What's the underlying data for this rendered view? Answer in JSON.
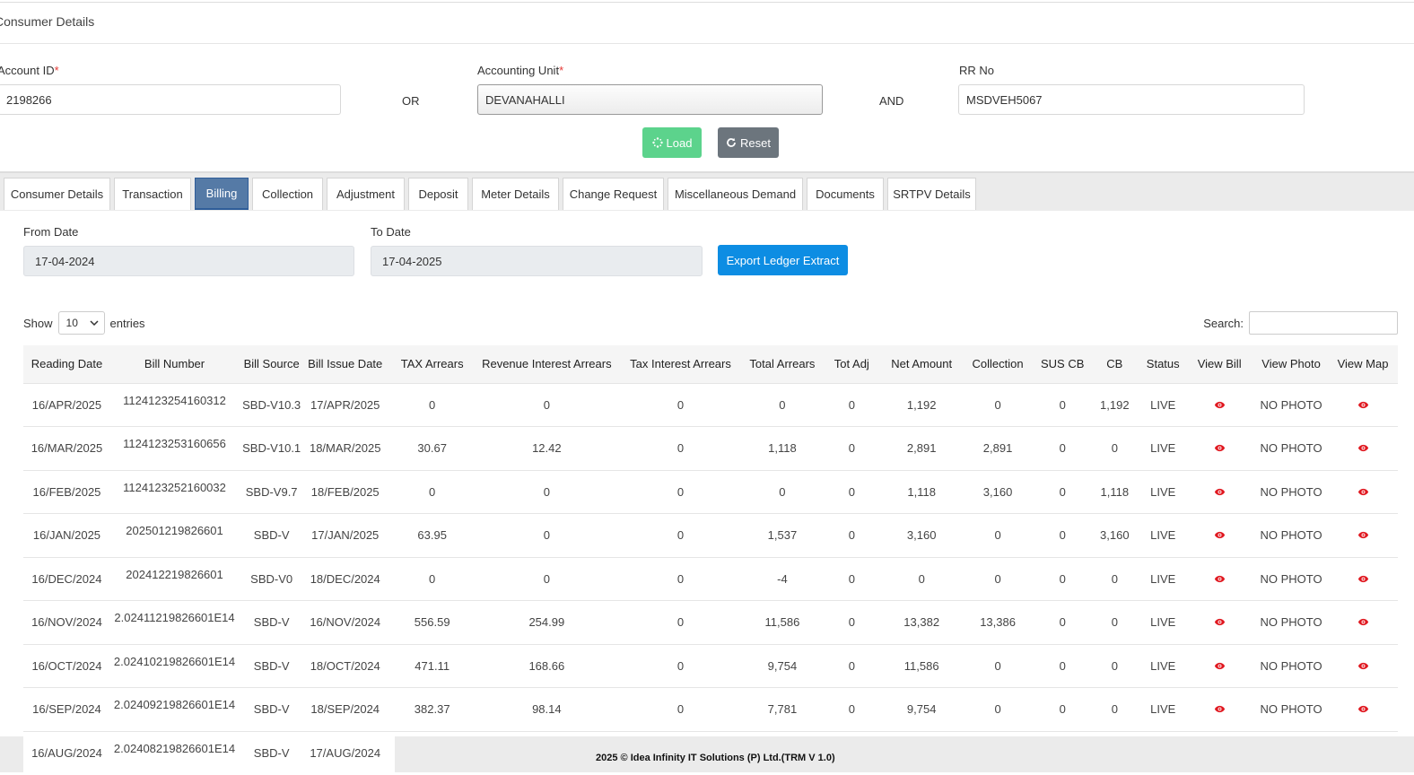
{
  "header": {
    "title": "Consumer Details"
  },
  "form": {
    "account_id": {
      "label": "Account ID",
      "required": "*",
      "value": "2198266"
    },
    "or_label": "OR",
    "accounting_unit": {
      "label": "Accounting Unit",
      "required": "*",
      "value": "DEVANAHALLI"
    },
    "and_label": "AND",
    "rr_no": {
      "label": "RR No",
      "value": "MSDVEH5067"
    },
    "load_label": "Load",
    "reset_label": "Reset"
  },
  "tabs": [
    {
      "label": "Consumer Details"
    },
    {
      "label": "Transaction"
    },
    {
      "label": "Billing",
      "active": true
    },
    {
      "label": "Collection"
    },
    {
      "label": "Adjustment"
    },
    {
      "label": "Deposit"
    },
    {
      "label": "Meter Details"
    },
    {
      "label": "Change Request"
    },
    {
      "label": "Miscellaneous Demand"
    },
    {
      "label": "Documents"
    },
    {
      "label": "SRTPV Details"
    }
  ],
  "billing": {
    "from_date": {
      "label": "From Date",
      "value": "17-04-2024"
    },
    "to_date": {
      "label": "To Date",
      "value": "17-04-2025"
    },
    "export_label": "Export Ledger Extract",
    "show_label": "Show",
    "page_length": "10",
    "entries_label": "entries",
    "search_label": "Search:"
  },
  "table": {
    "columns": [
      "Reading Date",
      "Bill Number",
      "Bill Source",
      "Bill Issue Date",
      "TAX Arrears",
      "Revenue Interest Arrears",
      "Tax Interest Arrears",
      "Total Arrears",
      "Tot Adj",
      "Net Amount",
      "Collection",
      "SUS CB",
      "CB",
      "Status",
      "View Bill",
      "View Photo",
      "View Map"
    ],
    "rows": [
      [
        "16/APR/2025",
        "1124123254160312",
        "SBD-V10.3",
        "17/APR/2025",
        "0",
        "0",
        "0",
        "0",
        "0",
        "1,192",
        "0",
        "0",
        "1,192",
        "LIVE",
        "",
        "NO PHOTO",
        ""
      ],
      [
        "16/MAR/2025",
        "1124123253160656",
        "SBD-V10.1",
        "18/MAR/2025",
        "30.67",
        "12.42",
        "0",
        "1,118",
        "0",
        "2,891",
        "2,891",
        "0",
        "0",
        "LIVE",
        "",
        "NO PHOTO",
        ""
      ],
      [
        "16/FEB/2025",
        "1124123252160032",
        "SBD-V9.7",
        "18/FEB/2025",
        "0",
        "0",
        "0",
        "0",
        "0",
        "1,118",
        "3,160",
        "0",
        "1,118",
        "LIVE",
        "",
        "NO PHOTO",
        ""
      ],
      [
        "16/JAN/2025",
        "202501219826601",
        "SBD-V",
        "17/JAN/2025",
        "63.95",
        "0",
        "0",
        "1,537",
        "0",
        "3,160",
        "0",
        "0",
        "3,160",
        "LIVE",
        "",
        "NO PHOTO",
        ""
      ],
      [
        "16/DEC/2024",
        "202412219826601",
        "SBD-V0",
        "18/DEC/2024",
        "0",
        "0",
        "0",
        "-4",
        "0",
        "0",
        "0",
        "0",
        "0",
        "LIVE",
        "",
        "NO PHOTO",
        ""
      ],
      [
        "16/NOV/2024",
        "2.02411219826601E14",
        "SBD-V",
        "16/NOV/2024",
        "556.59",
        "254.99",
        "0",
        "11,586",
        "0",
        "13,382",
        "13,386",
        "0",
        "0",
        "LIVE",
        "",
        "NO PHOTO",
        ""
      ],
      [
        "16/OCT/2024",
        "2.02410219826601E14",
        "SBD-V",
        "18/OCT/2024",
        "471.11",
        "168.66",
        "0",
        "9,754",
        "0",
        "11,586",
        "0",
        "0",
        "0",
        "LIVE",
        "",
        "NO PHOTO",
        ""
      ],
      [
        "16/SEP/2024",
        "2.02409219826601E14",
        "SBD-V",
        "18/SEP/2024",
        "382.37",
        "98.14",
        "0",
        "7,781",
        "0",
        "9,754",
        "0",
        "0",
        "0",
        "LIVE",
        "",
        "NO PHOTO",
        ""
      ],
      [
        "16/AUG/2024",
        "2.02408219826601E14",
        "SBD-V",
        "17/AUG/2024",
        "",
        "",
        "",
        "",
        "",
        "",
        "",
        "",
        "",
        "",
        "",
        "",
        ""
      ]
    ]
  },
  "footer": {
    "text": "2025 © Idea Infinity IT Solutions (P) Ltd.(TRM V 1.0)"
  },
  "colors": {
    "accent": "#0d8de3",
    "active_tab": "#557aa6",
    "eye_icon": "#e0171f"
  }
}
